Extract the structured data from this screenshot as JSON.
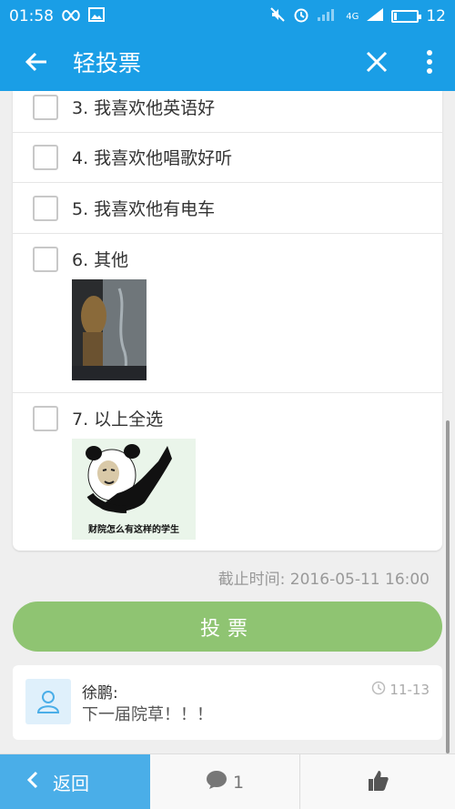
{
  "status_bar": {
    "time": "01:58",
    "network": "4G",
    "battery": "12",
    "battery_level": 0.12,
    "icons": [
      "infinity-icon",
      "image-icon",
      "mute-icon",
      "alarm-icon",
      "signal-icon",
      "battery-icon"
    ]
  },
  "app_bar": {
    "title": "轻投票",
    "icons": [
      "back-arrow-icon",
      "close-icon",
      "more-vertical-icon"
    ]
  },
  "options": [
    {
      "label": "3. 我喜欢他英语好"
    },
    {
      "label": "4. 我喜欢他唱歌好听"
    },
    {
      "label": "5. 我喜欢他有电车"
    },
    {
      "label": "6. 其他",
      "image": "photo-thumbnail"
    },
    {
      "label": "7. 以上全选",
      "image": "panda-meme",
      "image_caption": "财院怎么有这样的学生"
    }
  ],
  "deadline": "截止时间: 2016-05-11 16:00",
  "vote_button": "投票",
  "comment": {
    "name": "徐鹏:",
    "text": "下一届院草！！！",
    "time": "11-13"
  },
  "bottom_bar": {
    "back_label": "返回",
    "comment_count": "1"
  },
  "colors": {
    "primary": "#1a9ee6",
    "vote_button": "#8fc472",
    "back_tab": "#4aaee8"
  }
}
